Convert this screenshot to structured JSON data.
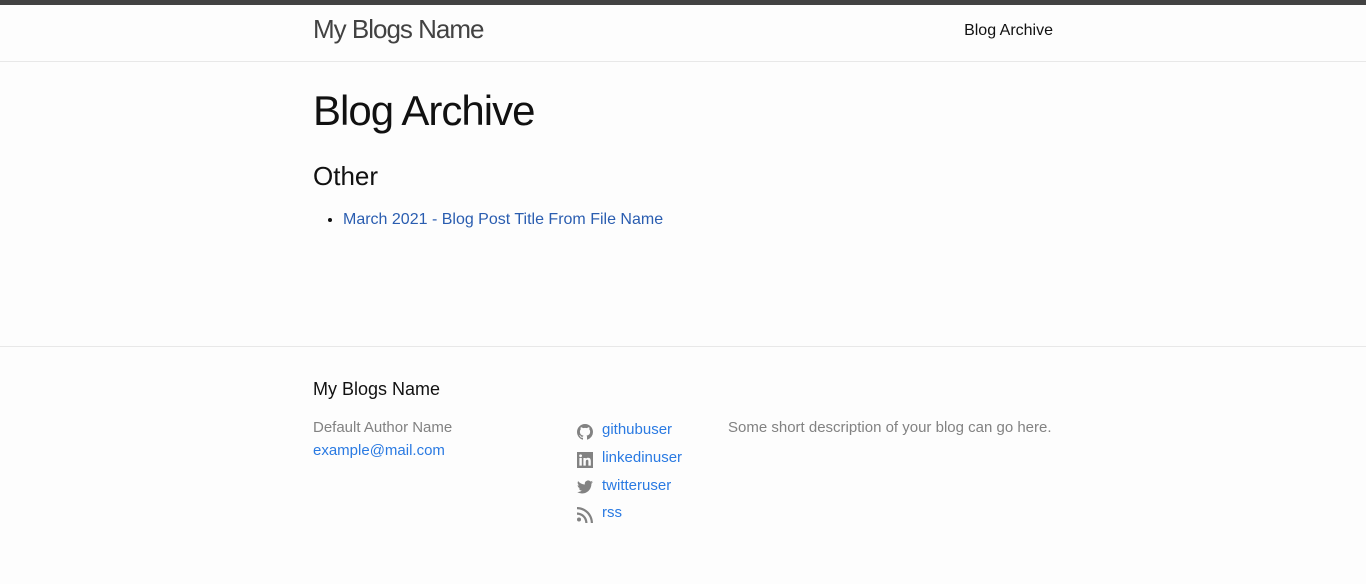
{
  "header": {
    "site_title": "My Blogs Name",
    "nav_link": "Blog Archive"
  },
  "main": {
    "page_heading": "Blog Archive",
    "category": "Other",
    "posts": [
      {
        "title": "March 2021 - Blog Post Title From File Name"
      }
    ]
  },
  "footer": {
    "heading": "My Blogs Name",
    "author_name": "Default Author Name",
    "email": "example@mail.com",
    "social": [
      {
        "icon": "github-icon",
        "label": "githubuser"
      },
      {
        "icon": "linkedin-icon",
        "label": "linkedinuser"
      },
      {
        "icon": "twitter-icon",
        "label": "twitteruser"
      },
      {
        "icon": "rss-icon",
        "label": "rss"
      }
    ],
    "description": "Some short description of your blog can go here."
  },
  "colors": {
    "top_border": "#424242",
    "link": "#2a7ae2",
    "post_link": "#2a5db0",
    "muted_text": "#828282"
  }
}
